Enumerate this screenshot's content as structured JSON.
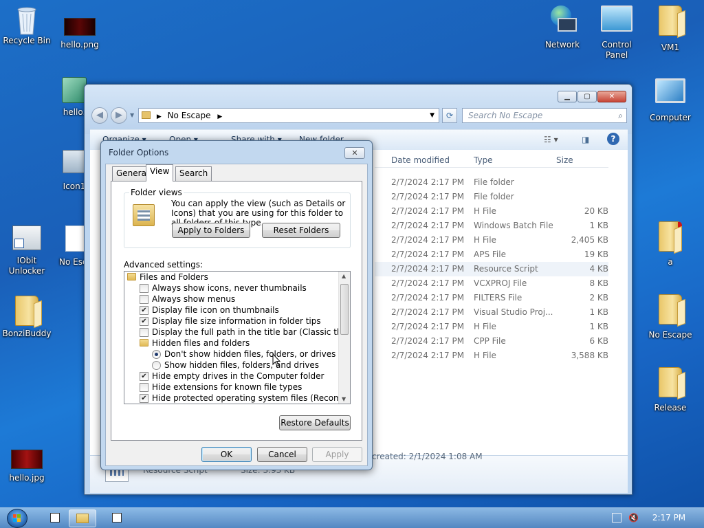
{
  "desktop": {
    "icons": {
      "recycle_bin": "Recycle Bin",
      "hello_png": "hello.png",
      "hello_partial": "hello.",
      "icon1": "Icon1",
      "iobit_unlocker": "IObit Unlocker",
      "no_escape_shortcut": "No Esca",
      "bonzibuddy": "BonziBuddy",
      "hello_jpg": "hello.jpg",
      "network": "Network",
      "control_panel": "Control Panel",
      "vm1": "VM1",
      "computer": "Computer",
      "a": "a",
      "no_escape": "No Escape",
      "release": "Release"
    }
  },
  "explorer": {
    "breadcrumb": "No Escape",
    "search_placeholder": "Search No Escape",
    "toolbar": {
      "organize": "Organize",
      "open": "Open",
      "share_with": "Share with",
      "new_folder": "New folder"
    },
    "columns": [
      "Date modified",
      "Type",
      "Size"
    ],
    "rows": [
      {
        "date": "2/7/2024 2:17 PM",
        "type": "File folder",
        "size": ""
      },
      {
        "date": "2/7/2024 2:17 PM",
        "type": "File folder",
        "size": ""
      },
      {
        "date": "2/7/2024 2:17 PM",
        "type": "H File",
        "size": "20 KB"
      },
      {
        "date": "2/7/2024 2:17 PM",
        "type": "Windows Batch File",
        "size": "1 KB"
      },
      {
        "date": "2/7/2024 2:17 PM",
        "type": "H File",
        "size": "2,405 KB"
      },
      {
        "date": "2/7/2024 2:17 PM",
        "type": "APS File",
        "size": "19 KB"
      },
      {
        "date": "2/7/2024 2:17 PM",
        "type": "Resource Script",
        "size": "4 KB"
      },
      {
        "date": "2/7/2024 2:17 PM",
        "type": "VCXPROJ File",
        "size": "8 KB"
      },
      {
        "date": "2/7/2024 2:17 PM",
        "type": "FILTERS File",
        "size": "2 KB"
      },
      {
        "date": "2/7/2024 2:17 PM",
        "type": "Visual Studio Proj...",
        "size": "1 KB"
      },
      {
        "date": "2/7/2024 2:17 PM",
        "type": "H File",
        "size": "1 KB"
      },
      {
        "date": "2/7/2024 2:17 PM",
        "type": "CPP File",
        "size": "6 KB"
      },
      {
        "date": "2/7/2024 2:17 PM",
        "type": "H File",
        "size": "3,588 KB"
      }
    ],
    "details": {
      "type": "Resource Script",
      "size": "Size: 3.93 KB",
      "created": "created: 2/1/2024 1:08 AM"
    }
  },
  "dialog": {
    "title": "Folder Options",
    "close": "✕",
    "tabs": {
      "general": "General",
      "view": "View",
      "search": "Search"
    },
    "folder_views": {
      "label": "Folder views",
      "description": "You can apply the view (such as Details or Icons) that you are using for this folder to all folders of this type.",
      "apply_button": "Apply to Folders",
      "reset_button": "Reset Folders"
    },
    "advanced_label": "Advanced settings:",
    "advanced": {
      "group": "Files and Folders",
      "always_icons": "Always show icons, never thumbnails",
      "always_menus": "Always show menus",
      "file_icon_thumbs": "Display file icon on thumbnails",
      "file_size_tips": "Display file size information in folder tips",
      "full_path": "Display the full path in the title bar (Classic theme only)",
      "hidden_group": "Hidden files and folders",
      "dont_show_hidden": "Don't show hidden files, folders, or drives",
      "show_hidden": "Show hidden files, folders, and drives",
      "hide_empty_drives": "Hide empty drives in the Computer folder",
      "hide_extensions": "Hide extensions for known file types",
      "hide_protected": "Hide protected operating system files (Recommended)"
    },
    "restore_defaults": "Restore Defaults",
    "ok": "OK",
    "cancel": "Cancel",
    "apply": "Apply"
  },
  "taskbar": {
    "clock": "2:17 PM"
  },
  "colors": {
    "desktop": "#1a66c2",
    "window_frame": "#bcd5f0",
    "close_red": "#c74536"
  }
}
